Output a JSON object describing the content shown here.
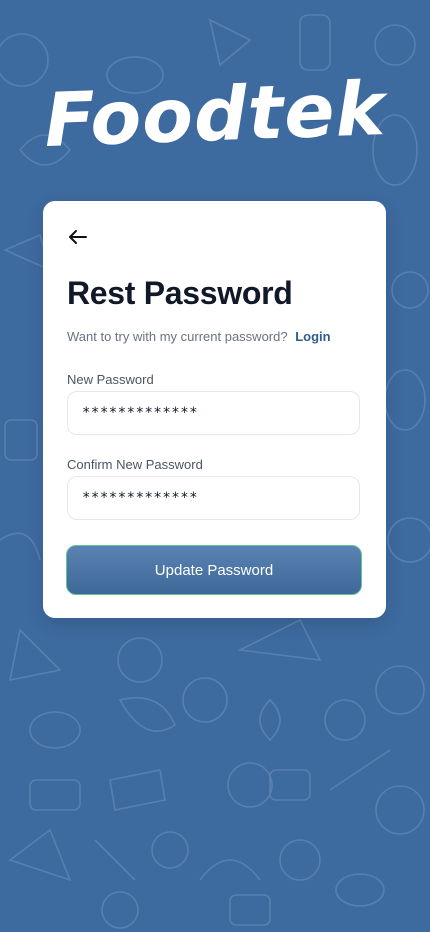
{
  "app": {
    "brand": "Foodtek"
  },
  "card": {
    "back_icon": "arrow-left-icon",
    "title": "Rest Password",
    "subtitle": "Want to try with my current password?",
    "login_link": "Login",
    "new_password": {
      "label": "New Password",
      "value": "*************"
    },
    "confirm_password": {
      "label": "Confirm New Password",
      "value": "*************"
    },
    "update_button": "Update Password"
  },
  "colors": {
    "background": "#3d6a9f",
    "card": "#ffffff",
    "accent": "#2f5d91",
    "button_border": "#64c29a"
  }
}
